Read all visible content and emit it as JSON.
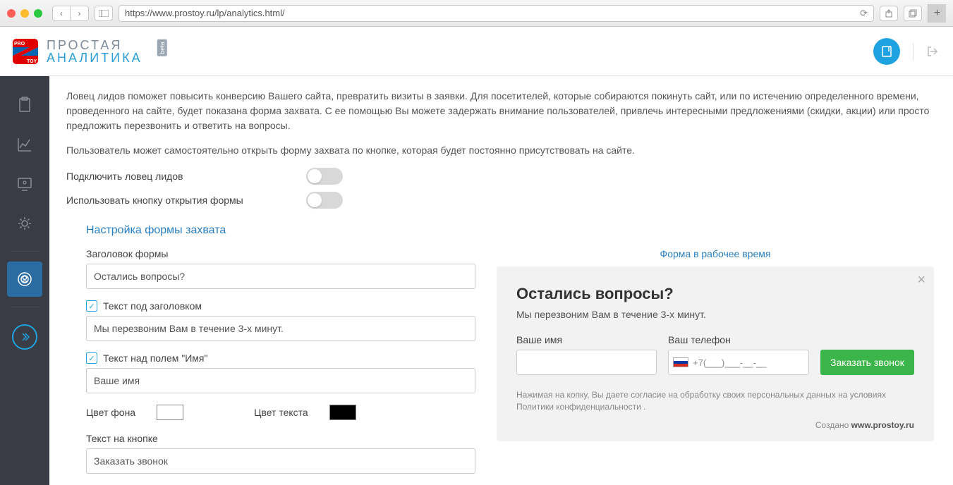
{
  "browser": {
    "url": "https://www.prostoy.ru/lp/analytics.html/"
  },
  "logo": {
    "line1": "ПРОСТАЯ",
    "line2": "АНАЛИТИКА",
    "beta": "beta"
  },
  "intro": {
    "p1": "Ловец лидов поможет повысить конверсию Вашего сайта, превратить визиты в заявки. Для посетителей, которые собираются покинуть сайт, или по истечению определенного времени, проведенного на сайте, будет показана форма захвата. С ее помощью Вы можете задержать внимание пользователей, привлечь интересными предложениями (скидки, акции) или просто предложить перезвонить и ответить на вопросы.",
    "p2": "Пользователь может самостоятельно открыть форму захвата по кнопке, которая будет постоянно присутствовать на сайте."
  },
  "toggles": {
    "lead_catcher": "Подключить ловец лидов",
    "use_button": "Использовать кнопку открытия формы"
  },
  "section_title": "Настройка формы захвата",
  "form": {
    "title_label": "Заголовок формы",
    "title_value": "Остались вопросы?",
    "subtitle_label": "Текст под заголовком",
    "subtitle_value": "Мы перезвоним Вам в течение 3-х минут.",
    "name_label_label": "Текст над полем \"Имя\"",
    "name_label_value": "Ваше имя",
    "bg_color_label": "Цвет фона",
    "text_color_label": "Цвет текста",
    "button_text_label": "Текст на кнопке",
    "button_text_value": "Заказать звонок"
  },
  "preview": {
    "header_link": "Форма в рабочее время",
    "title": "Остались вопросы?",
    "subtitle": "Мы перезвоним Вам в течение 3-х минут.",
    "name_label": "Ваше имя",
    "phone_label": "Ваш телефон",
    "phone_placeholder": "+7(___)___-__-__",
    "order_button": "Заказать звонок",
    "disclaimer": "Нажимая на копку, Вы даете согласие на обработку своих персональных данных на условиях Политики конфиденциальности .",
    "created_prefix": "Создано ",
    "created_site": "www.prostoy.ru"
  }
}
